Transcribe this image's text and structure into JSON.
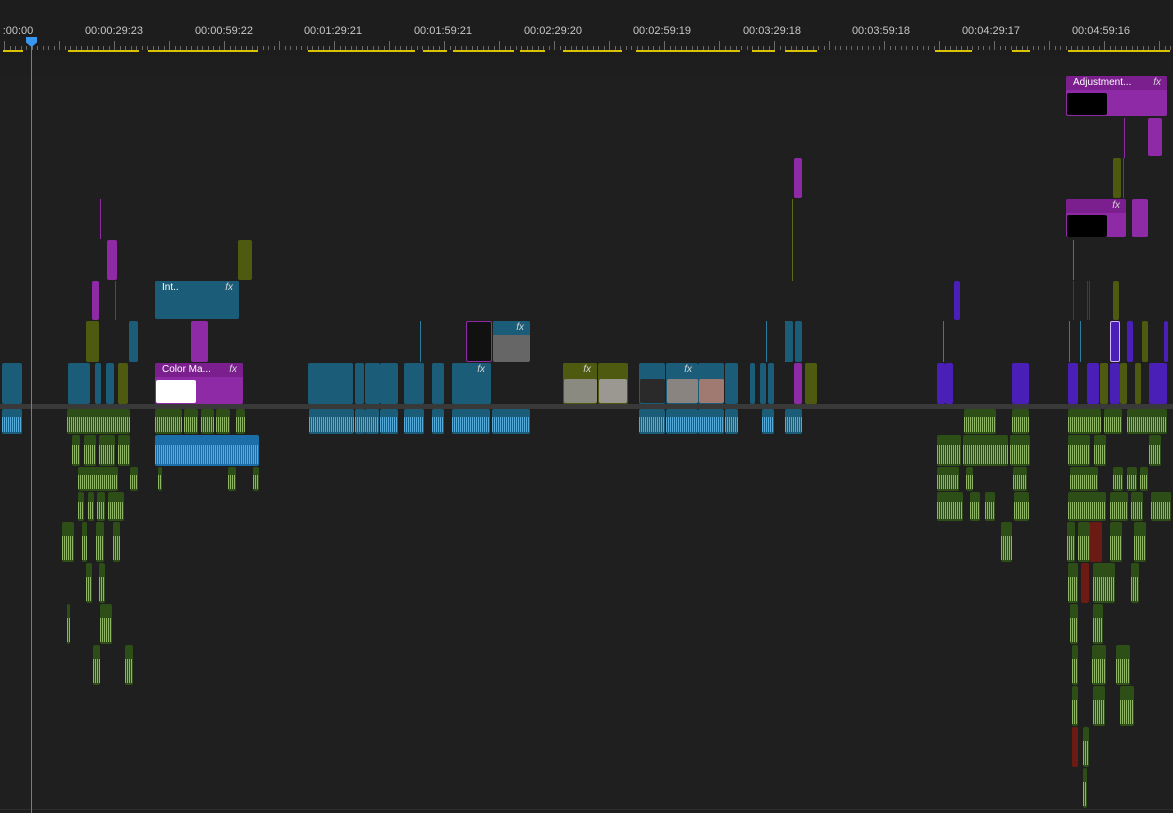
{
  "timeline": {
    "timecodes": [
      ":00:00",
      "00:00:29:23",
      "00:00:59:22",
      "00:01:29:21",
      "00:01:59:21",
      "00:02:29:20",
      "00:02:59:19",
      "00:03:29:18",
      "00:03:59:18",
      "00:04:29:17",
      "00:04:59:16"
    ],
    "labeled_clips": {
      "adjustment": {
        "label": "Adjustment...",
        "fx": "fx"
      },
      "intro": {
        "label": "Int..",
        "fx": "fx"
      },
      "color_matte": {
        "label": "Color Ma...",
        "fx": "fx"
      },
      "fx_badge": "fx"
    }
  },
  "colors": {
    "video_teal": "#1b5d78",
    "video_teal_light": "#2d7e9c",
    "purple": "#7b1f8e",
    "purple_bright": "#8e2aa6",
    "violet": "#4a1fb8",
    "olive": "#4e5a10",
    "audio_green": "#9ec672",
    "audio_green_dark": "#2e4e18",
    "audio_blue": "#5fb8e8",
    "audio_red": "#6b1a14",
    "playhead": "#2f8fe0",
    "workarea": "#d9c200"
  }
}
